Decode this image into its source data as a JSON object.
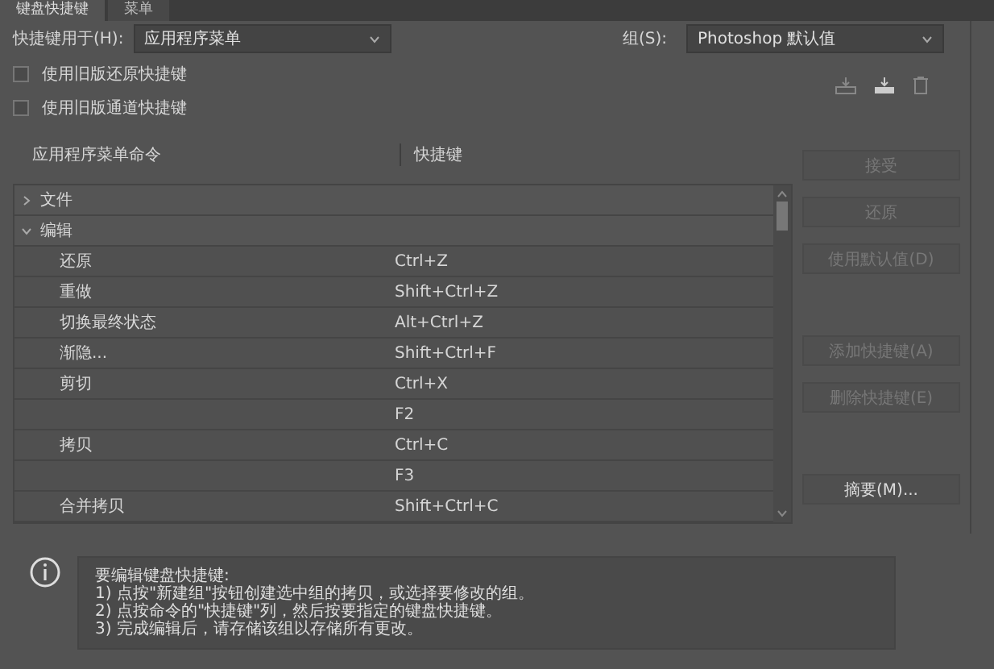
{
  "tabs": [
    {
      "label": "键盘快捷键",
      "selected": true
    },
    {
      "label": "菜单",
      "selected": false
    }
  ],
  "shortcuts_for": {
    "label": "快捷键用于(H):",
    "value": "应用程序菜单"
  },
  "group": {
    "label": "组(S):",
    "value": "Photoshop 默认值"
  },
  "options": [
    {
      "label": "使用旧版还原快捷键",
      "checked": false
    },
    {
      "label": "使用旧版通道快捷键",
      "checked": false
    }
  ],
  "table": {
    "columns": [
      "应用程序菜单命令",
      "快捷键"
    ],
    "rows": [
      {
        "command": "文件",
        "expanded": false,
        "children": []
      },
      {
        "command": "编辑",
        "expanded": true,
        "children": [
          {
            "command": "还原",
            "shortcut": "Ctrl+Z"
          },
          {
            "command": "重做",
            "shortcut": "Shift+Ctrl+Z"
          },
          {
            "command": "切换最终状态",
            "shortcut": "Alt+Ctrl+Z"
          },
          {
            "command": "渐隐...",
            "shortcut": "Shift+Ctrl+F"
          },
          {
            "command": "剪切",
            "shortcut": "Ctrl+X"
          },
          {
            "shortcut": "F2"
          },
          {
            "command": "拷贝",
            "shortcut": "Ctrl+C"
          },
          {
            "shortcut": "F3"
          },
          {
            "command": "合并拷贝",
            "shortcut": "Shift+Ctrl+C"
          }
        ]
      }
    ]
  },
  "buttons": [
    {
      "label": "接受",
      "disabled": true,
      "kind": "action"
    },
    {
      "label": "还原",
      "disabled": true,
      "kind": "action"
    },
    {
      "label": "使用默认值(D)",
      "disabled": true,
      "kind": "action"
    },
    {
      "label": "添加快捷键(A)",
      "disabled": true,
      "kind": "gap"
    },
    {
      "label": "删除快捷键(E)",
      "disabled": true,
      "kind": "action"
    },
    {
      "label": "摘要(M)...",
      "disabled": false,
      "kind": "gap"
    }
  ],
  "info": [
    "要编辑键盘快捷键:",
    "1) 点按\"新建组\"按钮创建选中组的拷贝，或选择要修改的组。",
    "2) 点按命令的\"快捷键\"列，然后按要指定的键盘快捷键。",
    "3) 完成编辑后，请存储该组以存储所有更改。"
  ]
}
